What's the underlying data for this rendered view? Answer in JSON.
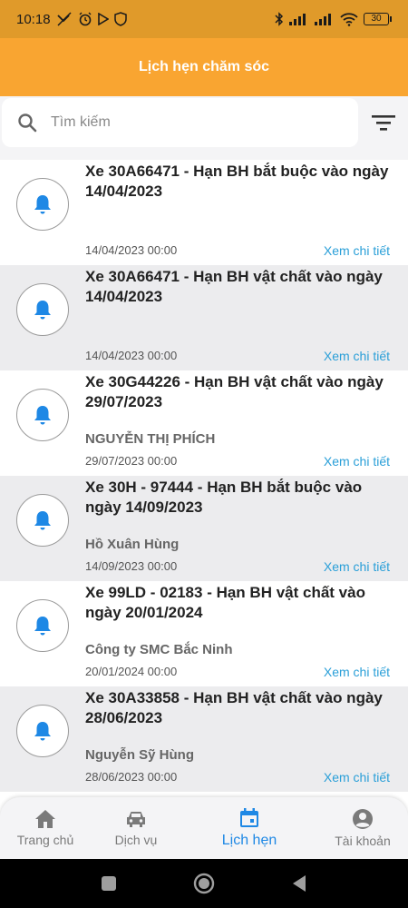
{
  "status": {
    "time": "10:18",
    "battery": "30"
  },
  "header": {
    "title": "Lịch hẹn chăm sóc"
  },
  "search": {
    "placeholder": "Tìm kiếm",
    "value": ""
  },
  "list": {
    "detail_label": "Xem chi tiết",
    "items": [
      {
        "title": "Xe 30A66471  - Hạn BH bắt buộc vào ngày 14/04/2023",
        "name": "",
        "date": "14/04/2023 00:00"
      },
      {
        "title": "Xe 30A66471  - Hạn BH vật chất vào ngày 14/04/2023",
        "name": "",
        "date": "14/04/2023 00:00"
      },
      {
        "title": "Xe 30G44226  - Hạn BH vật chất vào ngày 29/07/2023",
        "name": "NGUYỄN THỊ PHÍCH",
        "date": "29/07/2023 00:00"
      },
      {
        "title": "Xe 30H - 97444  - Hạn BH bắt buộc vào ngày 14/09/2023",
        "name": "Hồ Xuân Hùng",
        "date": "14/09/2023 00:00"
      },
      {
        "title": "Xe 99LD - 02183  - Hạn BH vật chất vào ngày 20/01/2024",
        "name": "Công ty SMC Bắc Ninh",
        "date": "20/01/2024 00:00"
      },
      {
        "title": "Xe 30A33858  - Hạn BH vật chất vào ngày 28/06/2023",
        "name": "Nguyễn Sỹ Hùng",
        "date": "28/06/2023 00:00"
      }
    ]
  },
  "nav": {
    "home": "Trang chủ",
    "services": "Dịch vụ",
    "appointments": "Lịch hẹn",
    "account": "Tài khoản"
  },
  "colors": {
    "status_bar": "#e09a2a",
    "header": "#f9a531",
    "accent": "#1e88e5",
    "link": "#2a9fd8"
  }
}
